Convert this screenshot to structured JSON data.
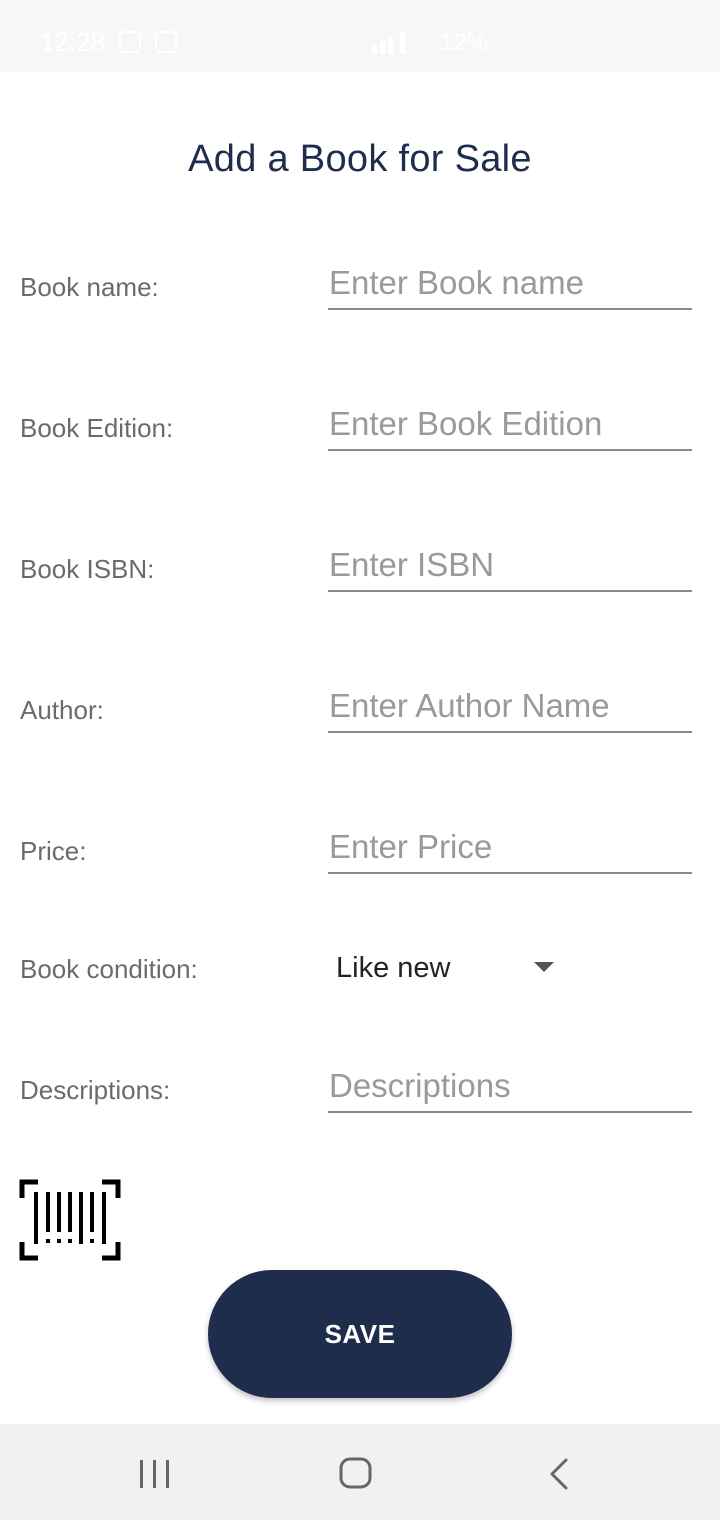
{
  "status_bar": {
    "time": "12:28",
    "battery": "12%"
  },
  "page": {
    "title": "Add a Book for Sale"
  },
  "form": {
    "book_name": {
      "label": "Book name:",
      "placeholder": "Enter Book name",
      "value": ""
    },
    "book_edition": {
      "label": "Book Edition:",
      "placeholder": "Enter Book Edition",
      "value": ""
    },
    "book_isbn": {
      "label": "Book ISBN:",
      "placeholder": "Enter ISBN",
      "value": ""
    },
    "author": {
      "label": "Author:",
      "placeholder": "Enter Author Name",
      "value": ""
    },
    "price": {
      "label": "Price:",
      "placeholder": "Enter Price",
      "value": ""
    },
    "condition": {
      "label": "Book condition:",
      "selected": "Like new"
    },
    "descriptions": {
      "label": "Descriptions:",
      "placeholder": "Descriptions",
      "value": ""
    }
  },
  "actions": {
    "barcode_icon": "barcode-scan-icon",
    "save_label": "SAVE"
  },
  "nav_bar": {
    "recents_icon": "recents-icon",
    "home_icon": "home-icon",
    "back_icon": "back-icon"
  },
  "colors": {
    "primary": "#1f2d4d",
    "label": "#6b6b6b",
    "placeholder": "#9a9a9a",
    "nav_bg": "#f1f1f1"
  }
}
